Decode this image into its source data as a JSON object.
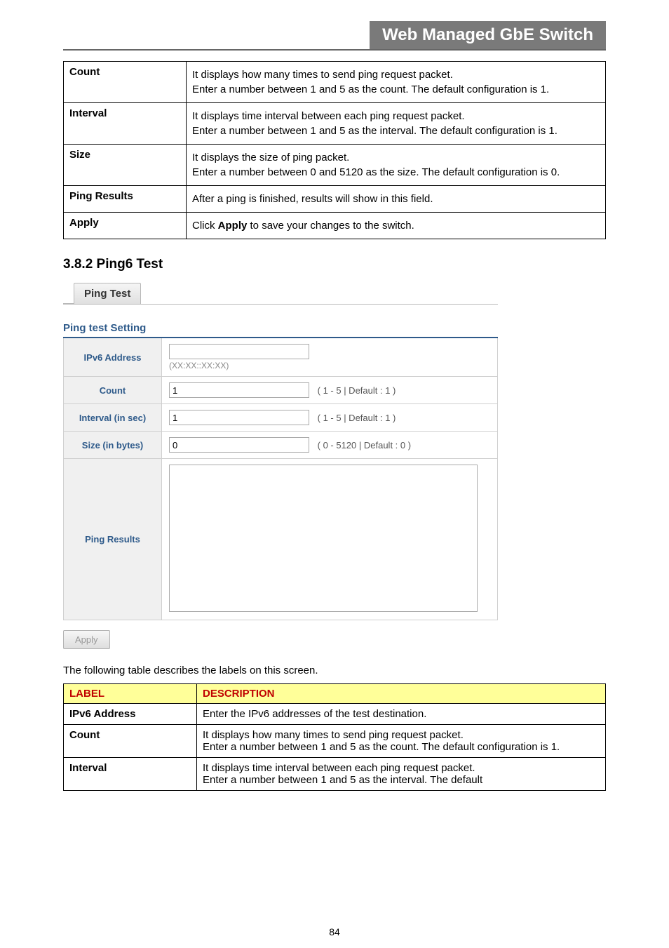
{
  "header_banner": "Web Managed GbE Switch",
  "top_table": {
    "rows": [
      {
        "label": "Count",
        "desc1": "It displays how many times to send ping request packet.",
        "desc2": "Enter a number between 1 and 5 as the count. The default configuration is 1."
      },
      {
        "label": "Interval",
        "desc1": "It displays time interval between each ping request packet.",
        "desc2": "Enter a number between 1 and 5 as the interval. The default configuration is 1."
      },
      {
        "label": "Size",
        "desc1": "It displays the size of ping packet.",
        "desc2": "Enter a number between 0 and 5120 as the size. The default configuration is 0."
      },
      {
        "label": "Ping Results",
        "desc1": "After a ping is finished, results will show in this field.",
        "desc2": ""
      },
      {
        "label": "Apply",
        "desc1_pre": "Click ",
        "desc1_bold": "Apply",
        "desc1_post": " to save your changes to the switch.",
        "desc2": ""
      }
    ]
  },
  "section_heading": "3.8.2 Ping6 Test",
  "tab_label": "Ping Test",
  "setting_heading": "Ping test Setting",
  "setting": {
    "ipv6_label": "IPv6 Address",
    "ipv6_value": "",
    "ipv6_hint": "(XX:XX::XX:XX)",
    "count_label": "Count",
    "count_value": "1",
    "count_hint": "( 1 - 5 | Default : 1 )",
    "interval_label": "Interval (in sec)",
    "interval_value": "1",
    "interval_hint": "( 1 - 5 | Default : 1 )",
    "size_label": "Size (in bytes)",
    "size_value": "0",
    "size_hint": "( 0 - 5120 | Default : 0 )",
    "results_label": "Ping Results",
    "results_value": ""
  },
  "apply_button": "Apply",
  "body_text": "The following table describes the labels on this screen.",
  "bottom_table": {
    "header": {
      "c1": "LABEL",
      "c2": "DESCRIPTION"
    },
    "rows": [
      {
        "label": "IPv6 Address",
        "desc1": "Enter the IPv6 addresses of the test destination.",
        "desc2": ""
      },
      {
        "label": "Count",
        "desc1": "It displays how many times to send ping request packet.",
        "desc2": "Enter a number between 1 and 5 as the count. The default configuration is 1."
      },
      {
        "label": "Interval",
        "desc1": "It displays time interval between each ping request packet.",
        "desc2": "Enter a number between 1 and 5 as the interval. The default"
      }
    ]
  },
  "page_number": "84"
}
